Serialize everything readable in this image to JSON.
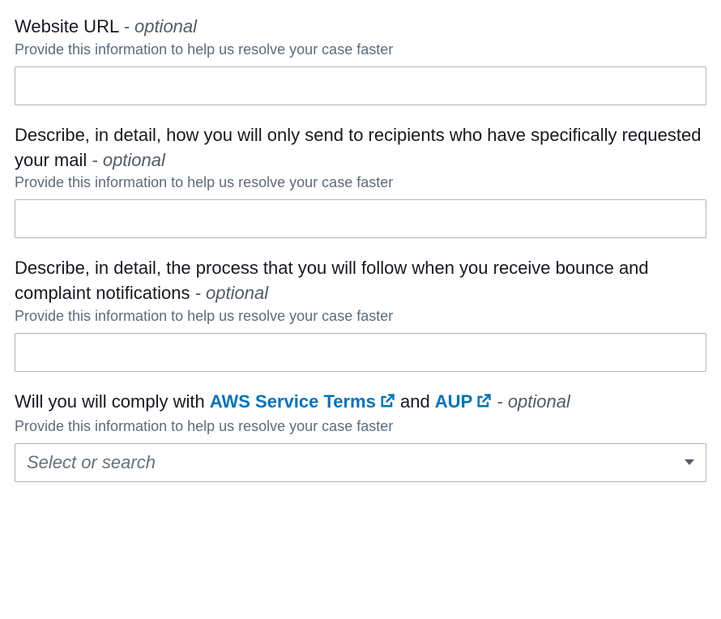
{
  "fields": {
    "website_url": {
      "label": "Website URL",
      "optional_suffix": "optional",
      "help": "Provide this information to help us resolve your case faster",
      "value": ""
    },
    "recipients": {
      "label": "Describe, in detail, how you will only send to recipients who have specifically requested your mail",
      "optional_suffix": "optional",
      "help": "Provide this information to help us resolve your case faster",
      "value": ""
    },
    "bounce": {
      "label": "Describe, in detail, the process that you will follow when you receive bounce and complaint notifications",
      "optional_suffix": "optional",
      "help": "Provide this information to help us resolve your case faster",
      "value": ""
    },
    "comply": {
      "label_prefix": "Will you will comply with ",
      "link1": "AWS Service Terms",
      "mid_text": " and ",
      "link2": "AUP",
      "label_suffix_dash": " - ",
      "optional_suffix": "optional",
      "help": "Provide this information to help us resolve your case faster",
      "placeholder": "Select or search"
    }
  }
}
